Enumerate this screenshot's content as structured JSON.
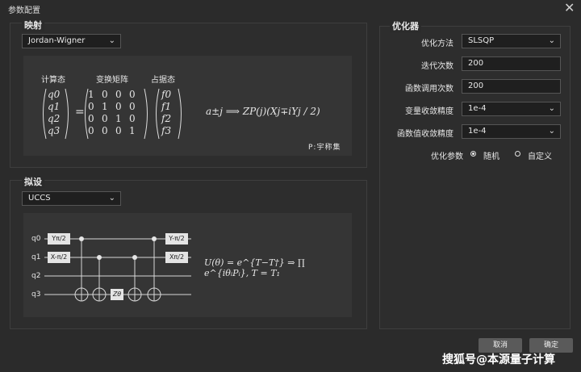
{
  "window": {
    "title": "参数配置",
    "close_glyph": "✕"
  },
  "mapping": {
    "title": "映射",
    "select_value": "Jordan-Wigner",
    "col_labels": [
      "计算态",
      "变换矩阵",
      "占据态"
    ],
    "q_vector": [
      "q0",
      "q1",
      "q2",
      "q3"
    ],
    "f_vector": [
      "f0",
      "f1",
      "f2",
      "f3"
    ],
    "matrix": [
      [
        "1",
        "0",
        "0",
        "0"
      ],
      [
        "0",
        "1",
        "0",
        "0"
      ],
      [
        "0",
        "0",
        "1",
        "0"
      ],
      [
        "0",
        "0",
        "0",
        "1"
      ]
    ],
    "equals": "=",
    "formula": "a±j ⟹ ZP(j)(Xj∓iYj / 2)",
    "note": "P:宇称集"
  },
  "ansatz": {
    "title": "拟设",
    "select_value": "UCCS",
    "qubits": [
      "q0",
      "q1",
      "q2",
      "q3"
    ],
    "gates": {
      "y_pi2": "Yπ/2",
      "x_neg_pi2": "X-π/2",
      "z_theta": "Zθ",
      "y_neg_pi2": "Y-π/2",
      "x_pi2": "Xπ/2"
    },
    "formula": "U(θ) = e^{T−T†} ⇒ ∏ e^{iθᵢPᵢ}, T = T₁"
  },
  "optimizer": {
    "title": "优化器",
    "fields": [
      {
        "label": "优化方法",
        "value": "SLSQP",
        "type": "select"
      },
      {
        "label": "迭代次数",
        "value": "200",
        "type": "input"
      },
      {
        "label": "函数调用次数",
        "value": "200",
        "type": "input"
      },
      {
        "label": "变量收敛精度",
        "value": "1e-4",
        "type": "select"
      },
      {
        "label": "函数值收敛精度",
        "value": "1e-4",
        "type": "select"
      }
    ],
    "params_label": "优化参数",
    "radio_random": "随机",
    "radio_custom": "自定义",
    "selected": "随机"
  },
  "buttons": {
    "cancel": "取消",
    "confirm": "确定"
  },
  "watermark": "搜狐号@本源量子计算"
}
